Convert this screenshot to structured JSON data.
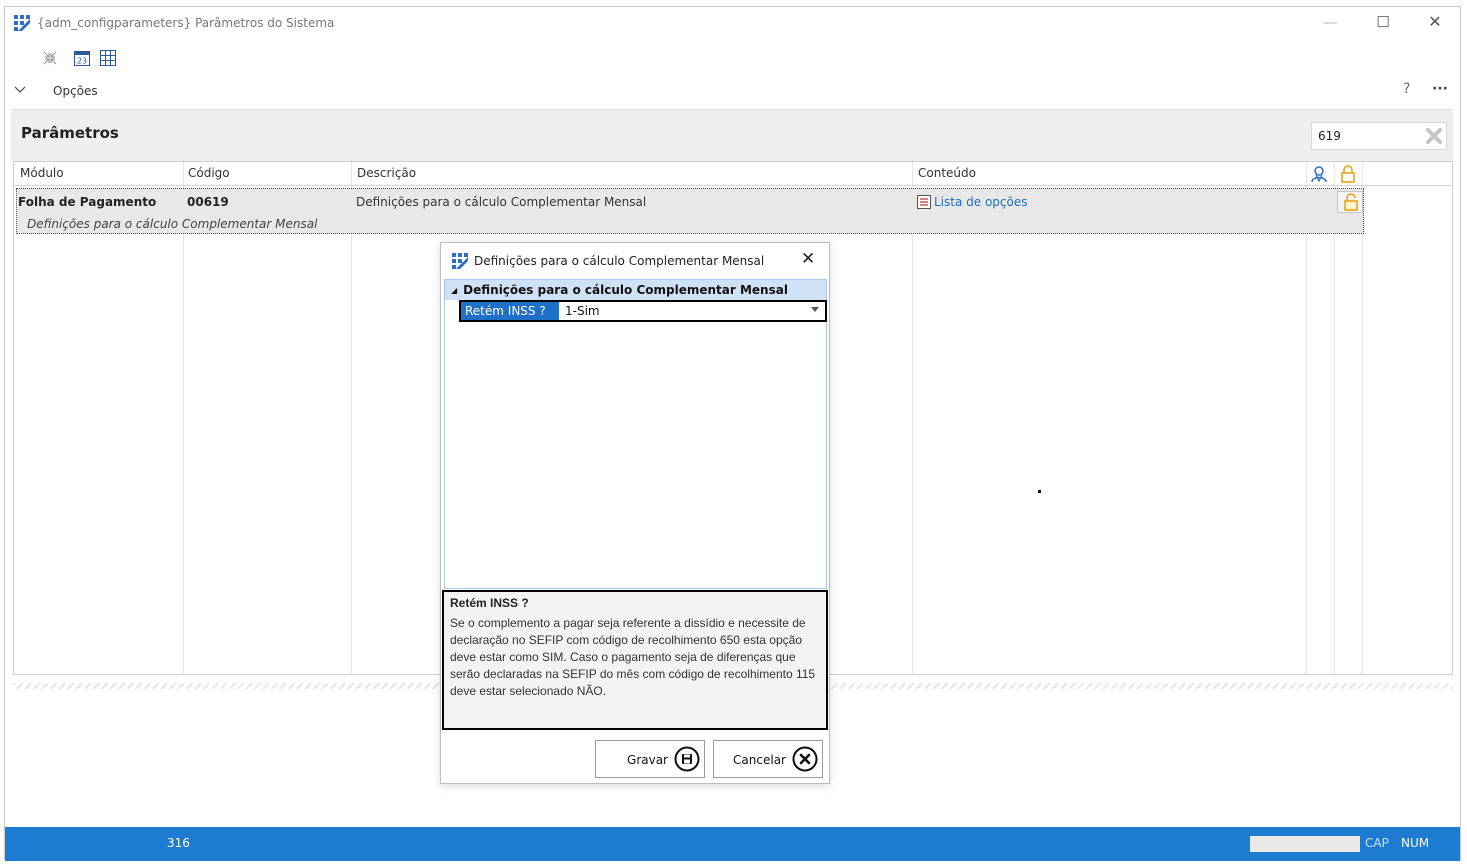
{
  "window": {
    "title": "{adm_configparameters} Parâmetros do Sistema",
    "minimize_glyph": "—",
    "maximize_glyph": "☐",
    "close_glyph": "✕"
  },
  "options": {
    "label": "Opções",
    "help_glyph": "?",
    "more_glyph": "···"
  },
  "panel": {
    "title": "Parâmetros",
    "search_value": "619"
  },
  "grid": {
    "columns": [
      "Módulo",
      "Código",
      "Descrição",
      "Conteúdo"
    ],
    "rows": [
      {
        "modulo": "Folha de Pagamento",
        "codigo": "00619",
        "descricao": "Definições para o cálculo Complementar Mensal",
        "conteudo": "Lista de opções",
        "subtitle": "Definições para o cálculo Complementar Mensal"
      }
    ]
  },
  "dialog": {
    "title": "Definições para o cálculo Complementar Mensal",
    "close_glyph": "✕",
    "category": "Definições para o cálculo Complementar Mensal",
    "property": {
      "name": "Retém INSS ?",
      "value": "1-Sim"
    },
    "help_title": "Retém INSS ?",
    "help_text": "Se o complemento a pagar seja referente a dissídio e necessite de declaração no SEFIP com código de recolhimento 650 esta opção deve estar como SIM. Caso o pagamento seja de diferenças que serão declaradas na SEFIP do mês com  código de recolhimento 115 deve estar selecionado NÃO.",
    "save_label": "Gravar",
    "cancel_label": "Cancelar"
  },
  "status": {
    "count": "316",
    "cap": "CAP",
    "num": "NUM"
  },
  "colors": {
    "accent": "#1e7bd2",
    "link": "#1a6fc9",
    "selection": "#1e6fc8",
    "lock": "#e8a317"
  }
}
